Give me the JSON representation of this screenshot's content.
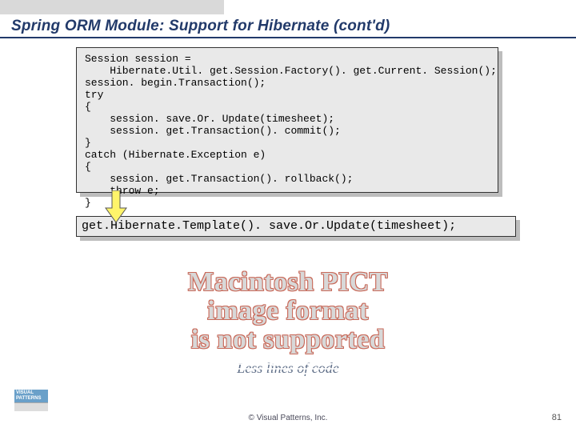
{
  "title": "Spring ORM Module: Support for Hibernate (cont'd)",
  "code_block_1": "Session session =\n    Hibernate.Util. get.Session.Factory(). get.Current. Session();\nsession. begin.Transaction();\ntry\n{\n    session. save.Or. Update(timesheet);\n    session. get.Transaction(). commit();\n}\ncatch (Hibernate.Exception e)\n{\n    session. get.Transaction(). rollback();\n    throw e;\n}",
  "code_block_2": "get.Hibernate.Template(). save.Or.Update(timesheet);",
  "pict_message": {
    "line1": "Macintosh PICT",
    "line2": "image format",
    "line3": "is not supported"
  },
  "caption": "Less lines of code",
  "logo_text": "VISUAL\nPATTERNS",
  "copyright": "© Visual Patterns, Inc.",
  "page_number": "81"
}
